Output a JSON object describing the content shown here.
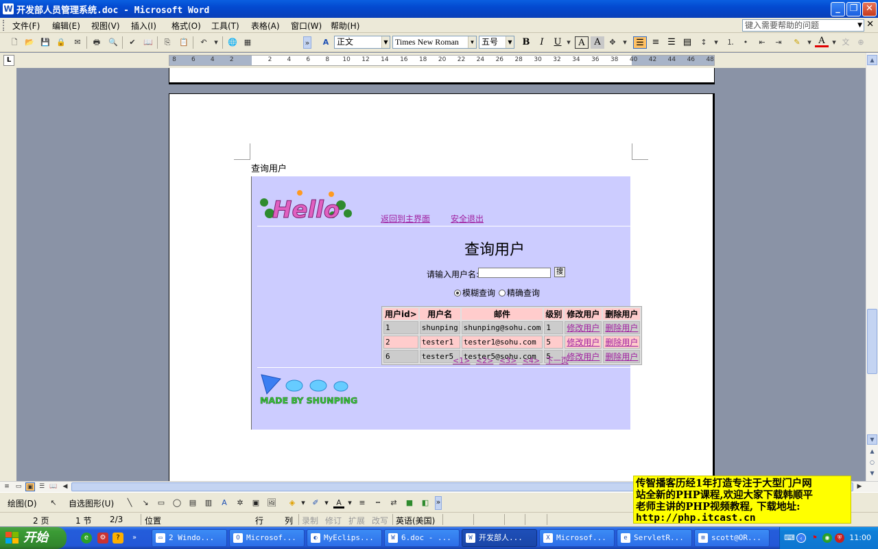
{
  "window": {
    "title": "开发部人员管理系统.doc - Microsoft Word",
    "app_icon": "W",
    "buttons": [
      "_",
      "❐",
      "✕"
    ]
  },
  "menu": {
    "items": [
      "文件(F)",
      "编辑(E)",
      "视图(V)",
      "插入(I)",
      "格式(O)",
      "工具(T)",
      "表格(A)",
      "窗口(W)",
      "帮助(H)"
    ],
    "help_placeholder": "键入需要帮助的问题",
    "close": "✕"
  },
  "toolbar": {
    "style": "正文",
    "font": "Times New Roman",
    "size": "五号",
    "bold": "B",
    "italic": "I",
    "underline": "U",
    "char_border": "A",
    "char_shading": "A",
    "font_color": "A"
  },
  "ruler": {
    "corner": "L",
    "ticks": [
      "8",
      "6",
      "4",
      "2",
      "",
      "2",
      "4",
      "6",
      "8",
      "10",
      "12",
      "14",
      "16",
      "18",
      "20",
      "22",
      "24",
      "26",
      "28",
      "30",
      "32",
      "34",
      "36",
      "38",
      "40",
      "42",
      "44",
      "46",
      "48"
    ]
  },
  "document": {
    "heading": "查询用户",
    "web": {
      "nav": [
        "返回到主界面",
        "安全退出"
      ],
      "title": "查询用户",
      "search_label": "请输入用户名:",
      "search_button": "搜",
      "search_value": "",
      "radio": [
        {
          "label": "模糊查询",
          "checked": true
        },
        {
          "label": "精确查询",
          "checked": false
        }
      ],
      "table": {
        "headers": [
          "用户id>",
          "用户名",
          "邮件",
          "级别",
          "修改用户",
          "删除用户"
        ],
        "rows": [
          [
            "1",
            "shunping",
            "shunping@sohu.com",
            "1",
            "修改用户",
            "删除用户"
          ],
          [
            "2",
            "tester1",
            "tester1@sohu.com",
            "5",
            "修改用户",
            "删除用户"
          ],
          [
            "6",
            "tester5",
            "tester5@sohu.com",
            "5",
            "修改用户",
            "删除用户"
          ]
        ]
      },
      "pager": [
        "<1>",
        "<2>",
        "<3>",
        "<4>",
        "下一页"
      ],
      "footer_text": "MADE BY SHUNPING"
    }
  },
  "drawbar": {
    "draw": "绘图(D)",
    "autoshapes": "自选图形(U)"
  },
  "status": {
    "page": "2 页",
    "section": "1 节",
    "pages": "2/3",
    "position": "位置",
    "line": "行",
    "col": "列",
    "rec": "录制",
    "trk": "修订",
    "ext": "扩展",
    "ovr": "改写",
    "lang": "英语(美国)"
  },
  "ad": {
    "lines": [
      "传智播客历经1年打造专注于大型门户网",
      "站全新的PHP课程,欢迎大家下载韩顺平",
      "老师主讲的PHP视频教程, 下载地址:",
      "http://php.itcast.cn"
    ]
  },
  "taskbar": {
    "start": "开始",
    "tasks": [
      {
        "label": "2 Windo...",
        "icon": "▭"
      },
      {
        "label": "Microsof...",
        "icon": "O"
      },
      {
        "label": "MyEclips...",
        "icon": "◐"
      },
      {
        "label": "6.doc - ...",
        "icon": "W"
      },
      {
        "label": "开发部人...",
        "icon": "W"
      },
      {
        "label": "Microsof...",
        "icon": "X"
      },
      {
        "label": "ServletR...",
        "icon": "e"
      },
      {
        "label": "scott@OR...",
        "icon": "⊞"
      }
    ],
    "clock": "11:00"
  },
  "colors": {
    "titlebar": "#0349d0",
    "web_bg": "#ccccff",
    "link": "#a020a0",
    "ad_bg": "#ffff00"
  }
}
